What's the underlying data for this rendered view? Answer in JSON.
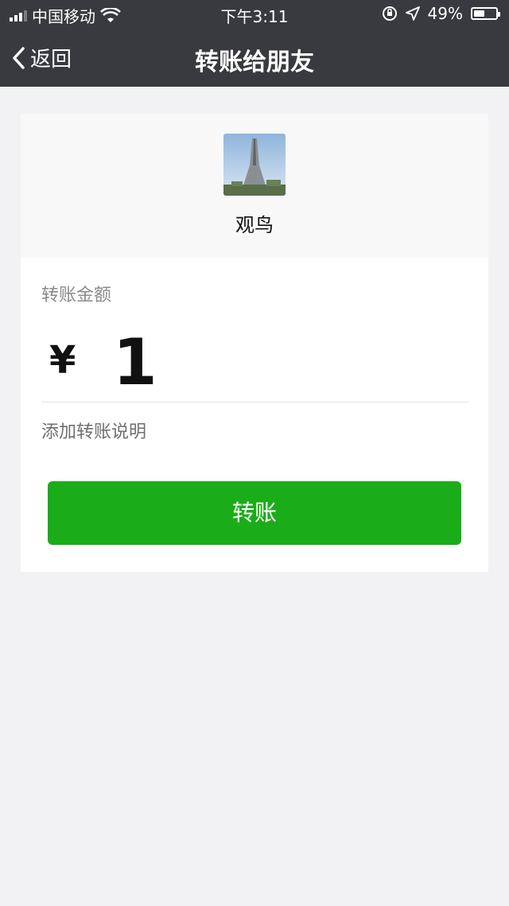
{
  "status_bar": {
    "carrier": "中国移动",
    "time": "下午3:11",
    "battery": "49%",
    "battery_level": 0.49,
    "icons": [
      "signal-icon",
      "wifi-icon",
      "rotation-lock-icon",
      "location-icon",
      "battery-icon"
    ]
  },
  "nav": {
    "back_label": "返回",
    "title": "转账给朋友"
  },
  "payee": {
    "name": "观鸟"
  },
  "form": {
    "amount_label": "转账金额",
    "currency_symbol": "¥",
    "amount": "1",
    "add_note": "添加转账说明",
    "submit_label": "转账"
  },
  "colors": {
    "nav_bg": "#393a3f",
    "page_bg": "#f2f2f4",
    "primary_button": "#1aad19"
  }
}
